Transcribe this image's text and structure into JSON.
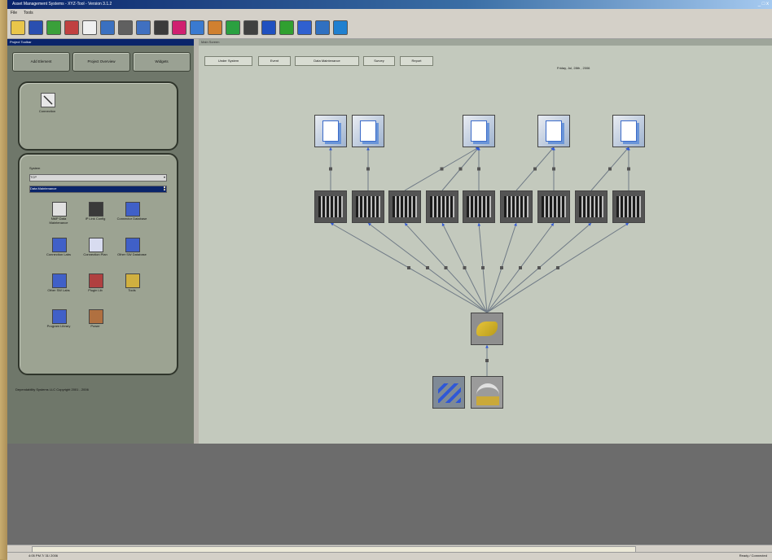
{
  "window": {
    "title": "Asset Management Systems - XYZ-Tool - Version 3.1.2",
    "controls": "_ □ x"
  },
  "menubar": {
    "items": [
      "File",
      "Tools"
    ]
  },
  "toolbar": {
    "buttons": [
      {
        "icon": "open-icon",
        "color": "#e9c64a"
      },
      {
        "icon": "save-icon",
        "color": "#2a4fb0"
      },
      {
        "icon": "refresh-icon",
        "color": "#3aa03a"
      },
      {
        "icon": "chart-icon",
        "color": "#c04040"
      },
      {
        "icon": "help-icon",
        "color": "#f0f0f0"
      },
      {
        "icon": "zoom-icon",
        "color": "#3a70c0"
      },
      {
        "icon": "print-icon",
        "color": "#606060"
      },
      {
        "icon": "connect-icon",
        "color": "#4070c0"
      },
      {
        "icon": "server-icon",
        "color": "#3b3b3b"
      },
      {
        "icon": "star-icon",
        "color": "#d02070"
      },
      {
        "icon": "grid-icon",
        "color": "#3a7ad0"
      },
      {
        "icon": "tool-icon",
        "color": "#d08030"
      },
      {
        "icon": "network-icon",
        "color": "#2aa040"
      },
      {
        "icon": "lock-icon",
        "color": "#404040"
      },
      {
        "icon": "graph-icon",
        "color": "#2050c0"
      },
      {
        "icon": "flag-icon",
        "color": "#30a030"
      },
      {
        "icon": "person-icon",
        "color": "#3060d0"
      },
      {
        "icon": "settings-icon",
        "color": "#3070c0"
      },
      {
        "icon": "user-icon",
        "color": "#2080d0"
      }
    ]
  },
  "left_pane": {
    "header": "Project Toolbar",
    "nav_buttons": [
      "Add Element",
      "Project Overview",
      "Widgets"
    ],
    "panel1": {
      "item_label": "Connection"
    },
    "panel2": {
      "label": "System",
      "select1": "TCP",
      "select2": "Data Maintenance",
      "items": [
        {
          "label": "NMP Data Maintenance",
          "icon": "monitor-icon"
        },
        {
          "label": "IP Link Config",
          "icon": "server-icon"
        },
        {
          "label": "Connector Database",
          "icon": "link-icon"
        },
        {
          "label": "Connection Labs",
          "icon": "link-icon"
        },
        {
          "label": "Connection Plan",
          "icon": "document-icon"
        },
        {
          "label": "Other SW Database",
          "icon": "link-icon"
        },
        {
          "label": "Other SW Labs",
          "icon": "link-icon"
        },
        {
          "label": "Plugin Lib",
          "icon": "plug-icon"
        },
        {
          "label": "Tools",
          "icon": "tools-icon"
        },
        {
          "label": "Program Library",
          "icon": "link-icon"
        },
        {
          "label": "Power",
          "icon": "power-icon"
        }
      ]
    },
    "copyright": "Dependability Systems LLC Copyright 2001 - 2006"
  },
  "canvas": {
    "header": "Main Screen",
    "tabs": [
      "Under System",
      "Event",
      "Data Maintenance",
      "Survey",
      "Report"
    ],
    "timestamp": "Friday, Jul, 28th , 2006"
  },
  "statusbar": {
    "left": "4:05 PM  7/ 31/ 2006",
    "right": "Ready / Connected"
  }
}
